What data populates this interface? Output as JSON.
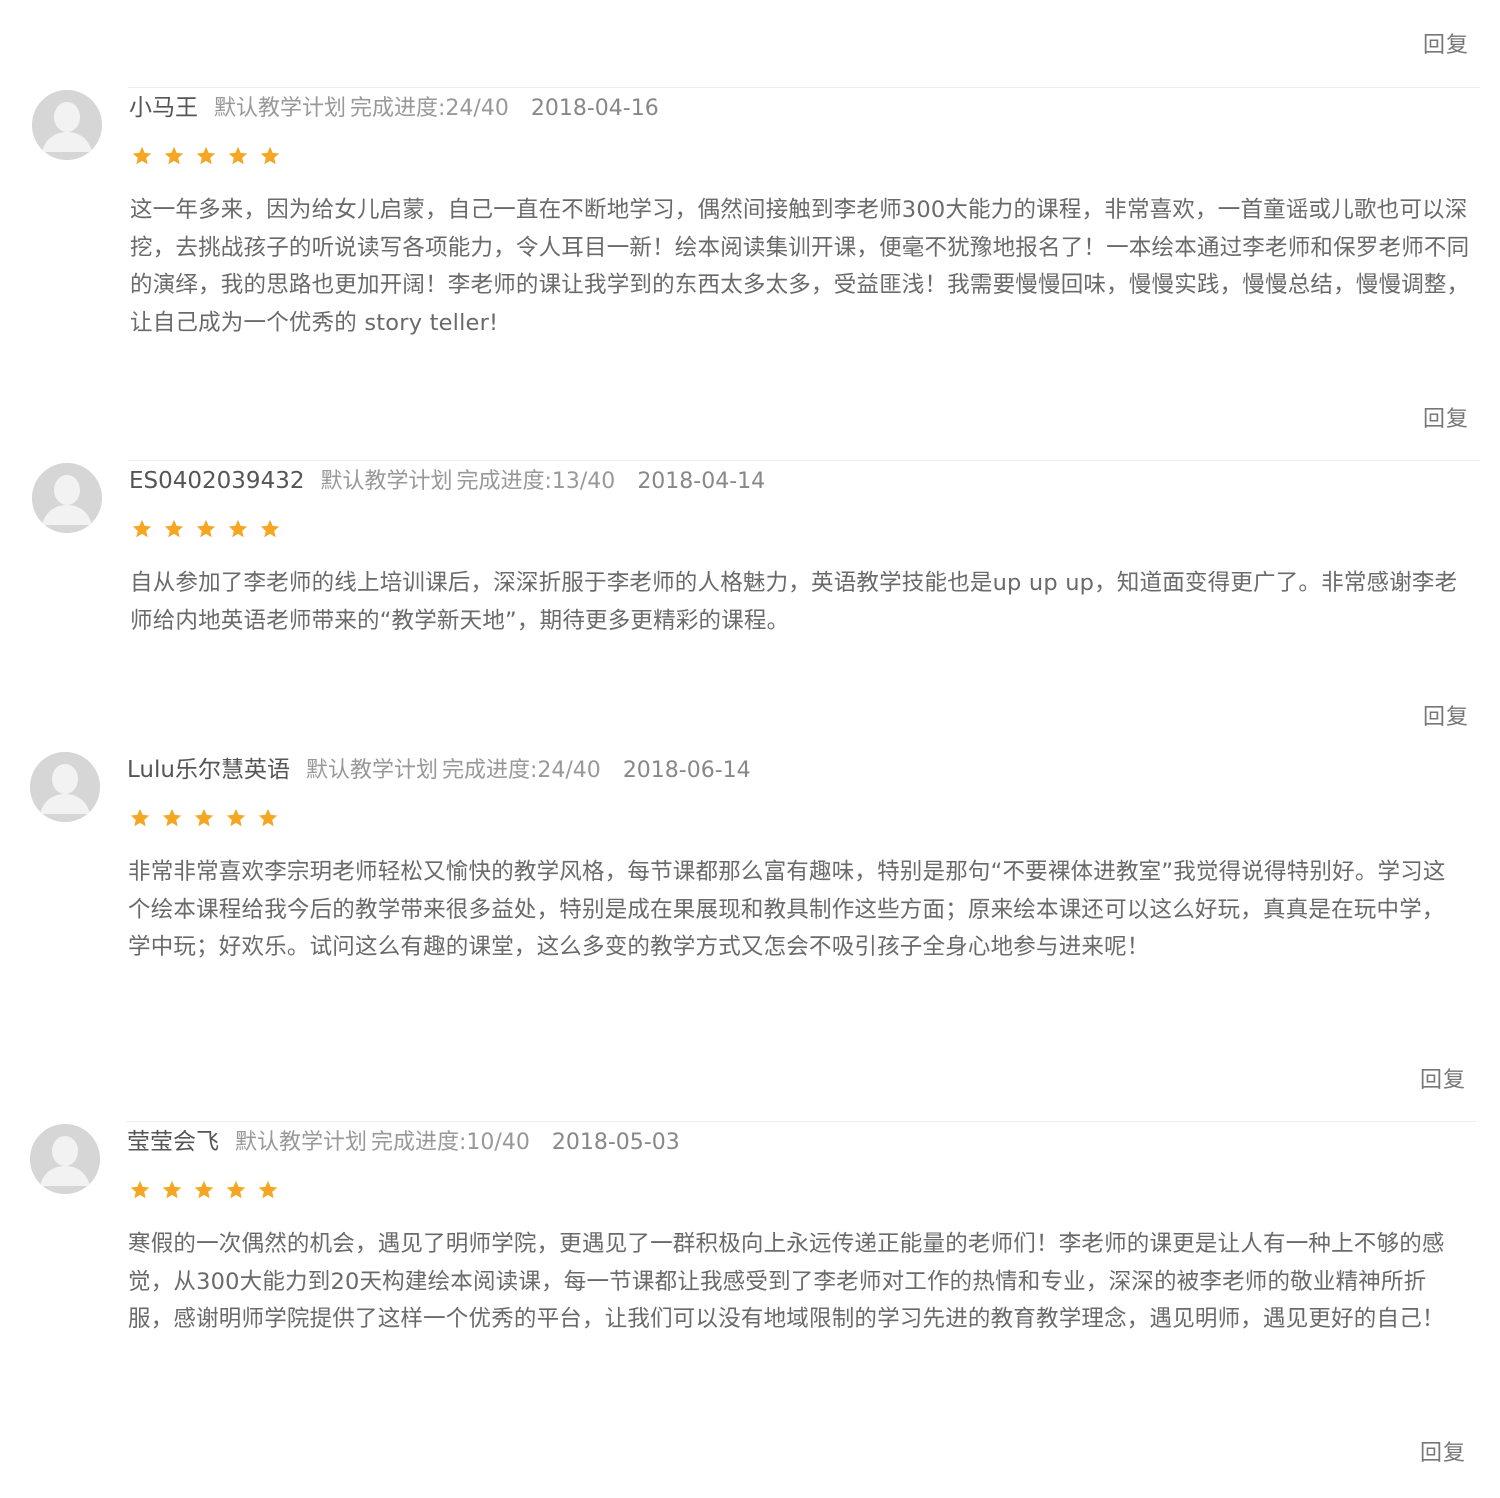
{
  "colors": {
    "star": "#f5a623",
    "avatar_bg": "#d6d6d6",
    "avatar_fg": "#f2f2f2",
    "text": "#6a6a6a"
  },
  "top_reply_label": "回复",
  "reviews": [
    {
      "name": "小马王",
      "plan": "默认教学计划",
      "progress": "完成进度:24/40",
      "date": "2018-04-16",
      "rating": 5,
      "comment": "这一年多来，因为给女儿启蒙，自己一直在不断地学习，偶然间接触到李老师300大能力的课程，非常喜欢，一首童谣或儿歌也可以深挖，去挑战孩子的听说读写各项能力，令人耳目一新！绘本阅读集训开课，便毫不犹豫地报名了！一本绘本通过李老师和保罗老师不同的演绎，我的思路也更加开阔！李老师的课让我学到的东西太多太多，受益匪浅！我需要慢慢回味，慢慢实践，慢慢总结，慢慢调整，让自己成为一个优秀的 story teller!",
      "reply_label": "回复"
    },
    {
      "name": "ES0402039432",
      "plan": "默认教学计划",
      "progress": "完成进度:13/40",
      "date": "2018-04-14",
      "rating": 5,
      "comment": "自从参加了李老师的线上培训课后，深深折服于李老师的人格魅力，英语教学技能也是up up up，知道面变得更广了。非常感谢李老师给内地英语老师带来的“教学新天地”，期待更多更精彩的课程。",
      "reply_label": "回复"
    },
    {
      "name": "Lulu乐尔慧英语",
      "plan": "默认教学计划",
      "progress": "完成进度:24/40",
      "date": "2018-06-14",
      "rating": 5,
      "comment": "非常非常喜欢李宗玥老师轻松又愉快的教学风格，每节课都那么富有趣味，特别是那句“不要裸体进教室”我觉得说得特别好。学习这个绘本课程给我今后的教学带来很多益处，特别是成在果展现和教具制作这些方面；原来绘本课还可以这么好玩，真真是在玩中学，学中玩；好欢乐。试问这么有趣的课堂，这么多变的教学方式又怎会不吸引孩子全身心地参与进来呢！",
      "reply_label": "回复"
    },
    {
      "name": "莹莹会飞",
      "plan": "默认教学计划",
      "progress": "完成进度:10/40",
      "date": "2018-05-03",
      "rating": 5,
      "comment": "寒假的一次偶然的机会，遇见了明师学院，更遇见了一群积极向上永远传递正能量的老师们！李老师的课更是让人有一种上不够的感觉，从300大能力到20天构建绘本阅读课，每一节课都让我感受到了李老师对工作的热情和专业，深深的被李老师的敬业精神所折服，感谢明师学院提供了这样一个优秀的平台，让我们可以没有地域限制的学习先进的教育教学理念，遇见明师，遇见更好的自己！",
      "reply_label": "回复"
    }
  ]
}
